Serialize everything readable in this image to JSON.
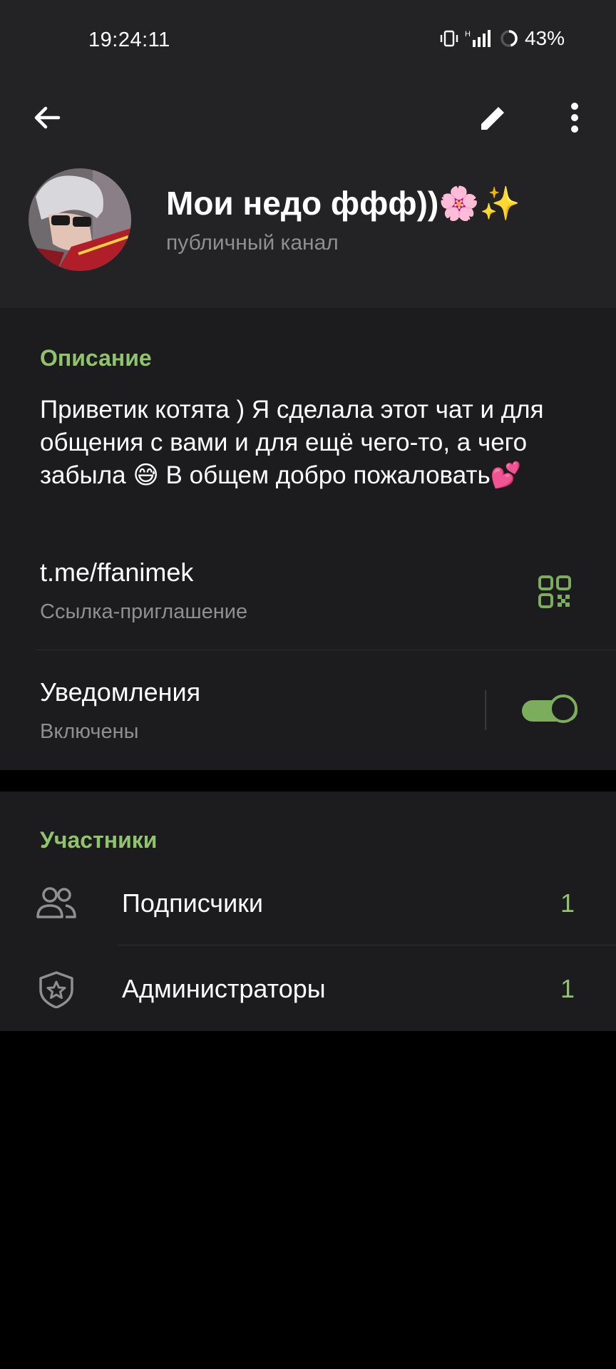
{
  "status_bar": {
    "time": "19:24:11",
    "battery": "43%"
  },
  "app_bar": {
    "back_icon": "arrow-left-icon",
    "edit_icon": "pencil-icon",
    "menu_icon": "more-vertical-icon"
  },
  "channel": {
    "title": "Мои недо ффф))🌸✨",
    "subtitle": "публичный канал"
  },
  "info": {
    "description_header": "Описание",
    "description": "Приветик котята ) Я сделала этот чат и для общения с вами и для ещё чего-то, а чего забыла 😅 В общем добро пожаловать💕",
    "link": "t.me/ffanimek",
    "link_label": "Ссылка-приглашение",
    "notifications_label": "Уведомления",
    "notifications_status": "Включены",
    "notifications_enabled": true
  },
  "members": {
    "header": "Участники",
    "rows": [
      {
        "label": "Подписчики",
        "count": "1",
        "icon": "people-icon"
      },
      {
        "label": "Администраторы",
        "count": "1",
        "icon": "shield-star-icon"
      }
    ]
  },
  "colors": {
    "accent": "#8fc46c",
    "surface": "#1c1c1e",
    "header_bg": "#232325",
    "background": "#000000"
  }
}
